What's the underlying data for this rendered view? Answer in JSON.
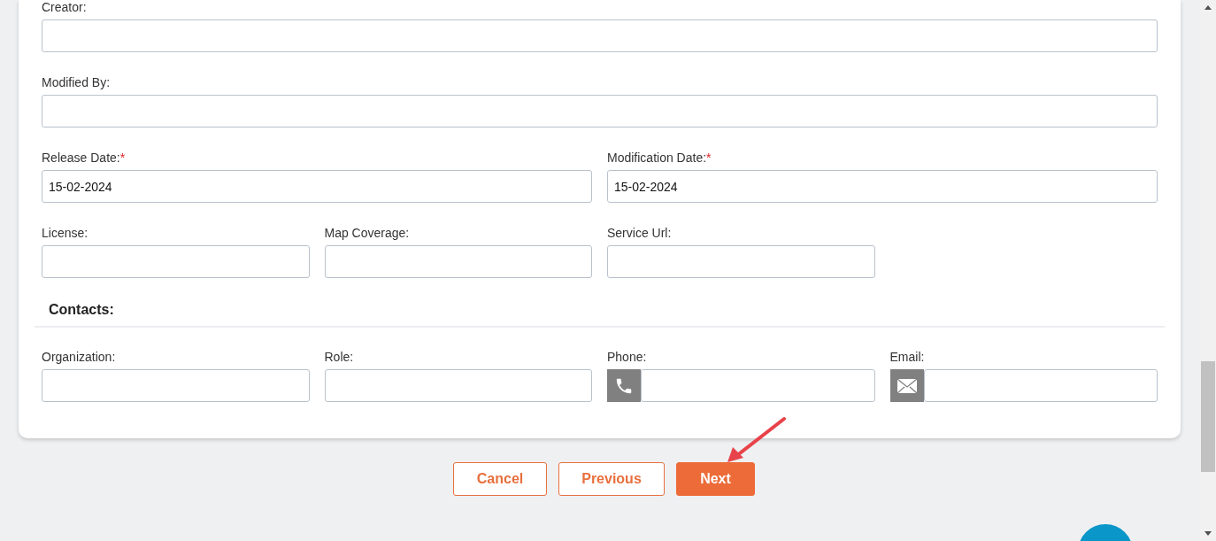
{
  "rows": [
    [
      {
        "label": "Creator:",
        "required": false
      }
    ],
    [
      {
        "label": "Modified By:",
        "required": false
      }
    ],
    [
      {
        "label": "Release Date:",
        "required": true,
        "value": "15-02-2024"
      },
      {
        "label": "Modification Date:",
        "required": true,
        "value": "15-02-2024"
      }
    ],
    [
      {
        "label": "License:",
        "required": false
      },
      {
        "label": "Map Coverage:",
        "required": false
      },
      {
        "label": "Service Url:",
        "required": false
      }
    ]
  ],
  "contacts": {
    "title": "Contacts:",
    "fields": [
      {
        "label": "Organization:",
        "kind": "text"
      },
      {
        "label": "Role:",
        "kind": "text"
      },
      {
        "label": "Phone:",
        "kind": "phone"
      },
      {
        "label": "Email:",
        "kind": "email"
      }
    ]
  },
  "required_mark": "*",
  "buttons": [
    {
      "label": "Cancel",
      "kind": "outline"
    },
    {
      "label": "Previous",
      "kind": "outline"
    },
    {
      "label": "Next",
      "kind": "primary"
    }
  ]
}
